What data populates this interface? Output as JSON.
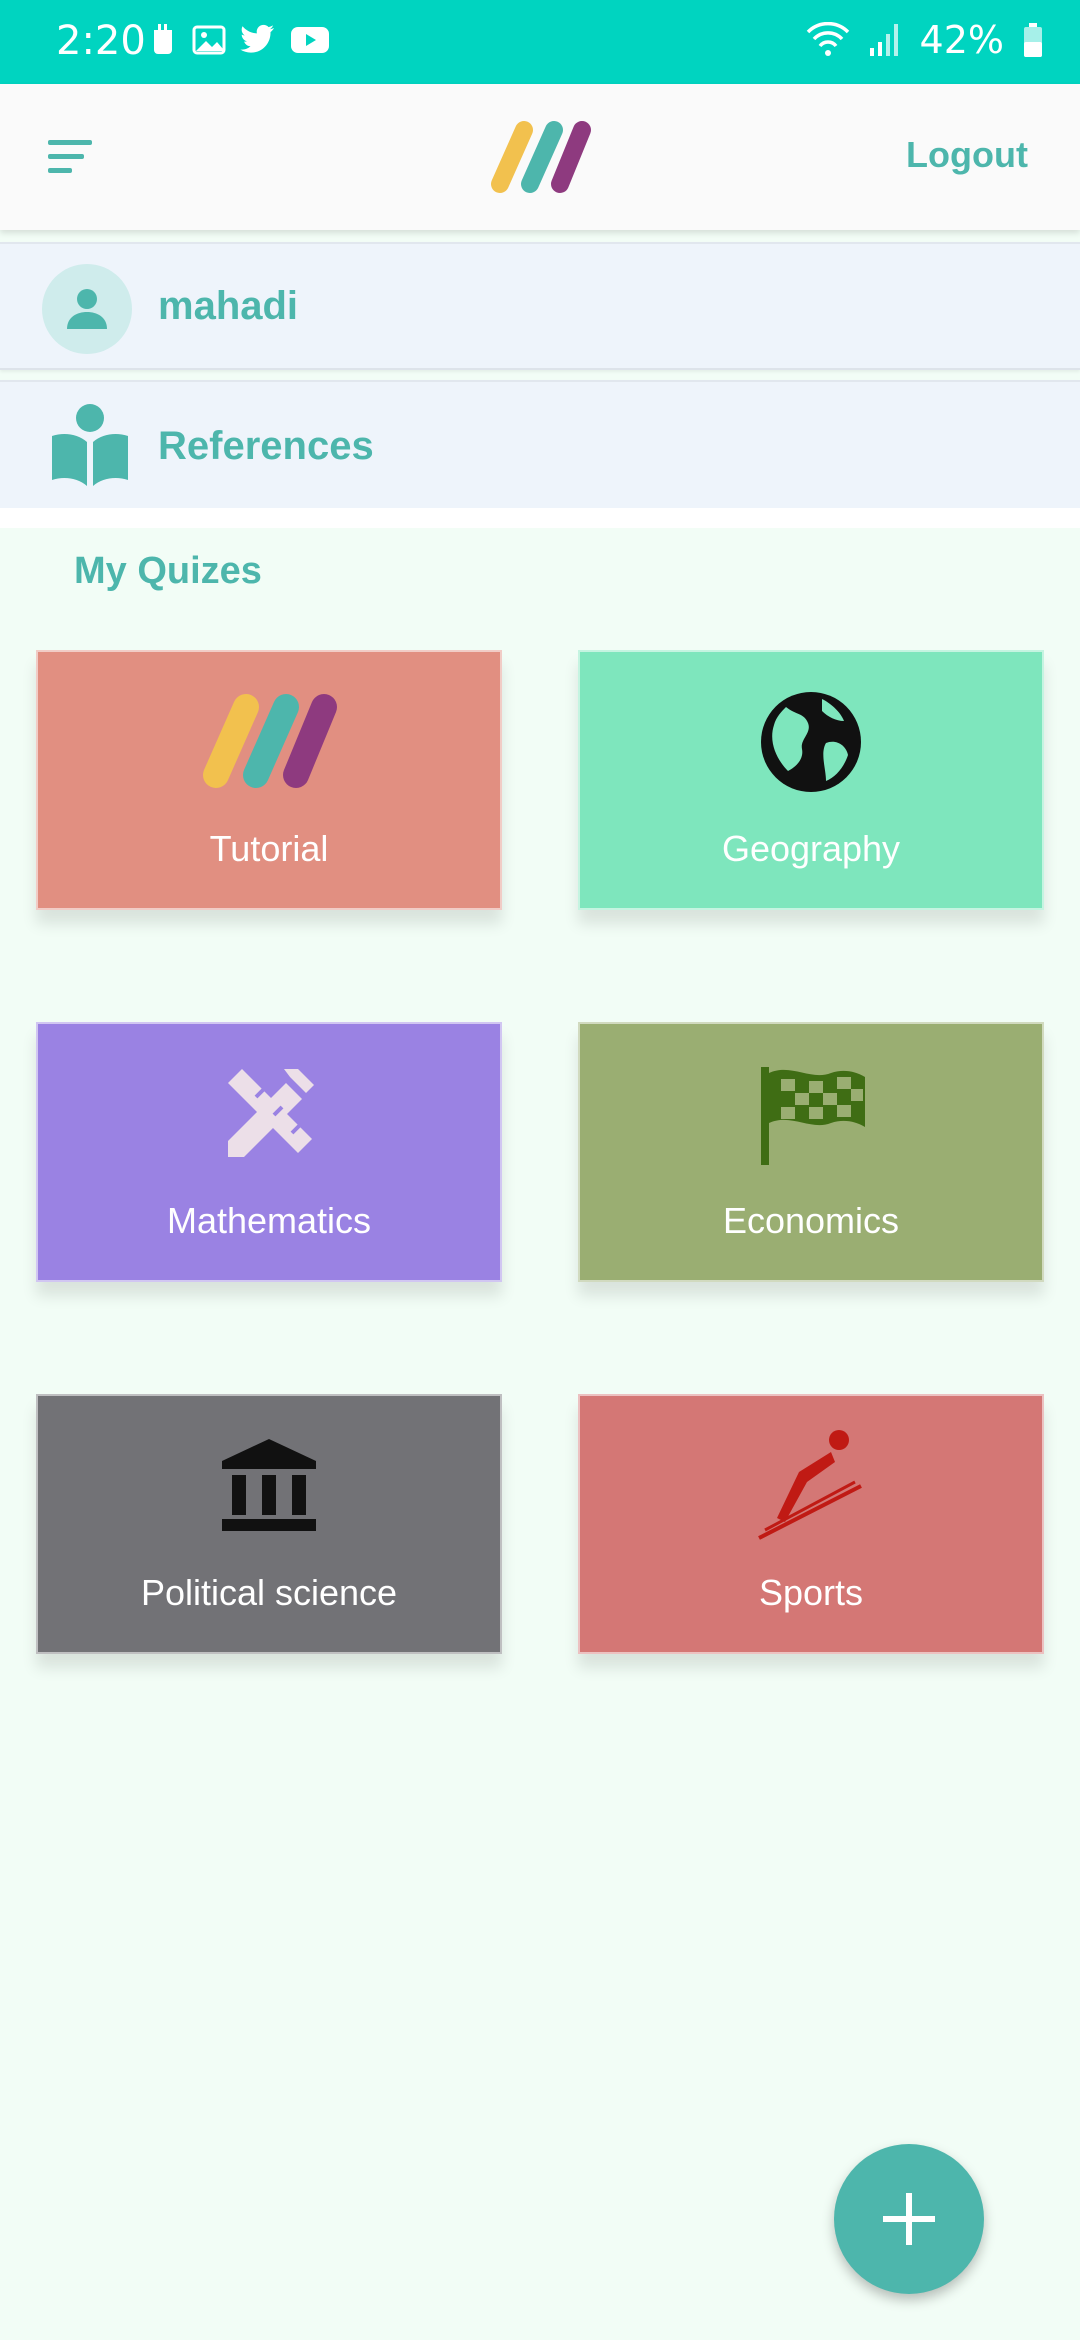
{
  "status_bar": {
    "time": "2:20",
    "battery_percent": "42%",
    "left_icons": [
      "notification-icon",
      "gallery-icon",
      "twitter-icon",
      "youtube-icon"
    ],
    "right_icons": [
      "wifi-icon",
      "signal-icon",
      "battery-icon"
    ]
  },
  "app_bar": {
    "logout_label": "Logout",
    "accent_color": "#4db6ac"
  },
  "user": {
    "name": "mahadi"
  },
  "references": {
    "label": "References"
  },
  "quizzes": {
    "section_title": "My Quizes",
    "items": [
      {
        "label": "Tutorial",
        "icon": "app-logo-icon",
        "color": "#e18f81"
      },
      {
        "label": "Geography",
        "icon": "globe-icon",
        "color": "#7ee6bd"
      },
      {
        "label": "Mathematics",
        "icon": "pencil-ruler-icon",
        "color": "#9a82e3"
      },
      {
        "label": "Economics",
        "icon": "checkered-flag-icon",
        "color": "#9aae72"
      },
      {
        "label": "Political science",
        "icon": "institution-icon",
        "color": "#727276"
      },
      {
        "label": "Sports",
        "icon": "ski-jump-icon",
        "color": "#d47775"
      }
    ]
  },
  "colors": {
    "status_bar": "#00d4c0",
    "background": "#f2fdf6",
    "fab": "#4db6ac"
  }
}
